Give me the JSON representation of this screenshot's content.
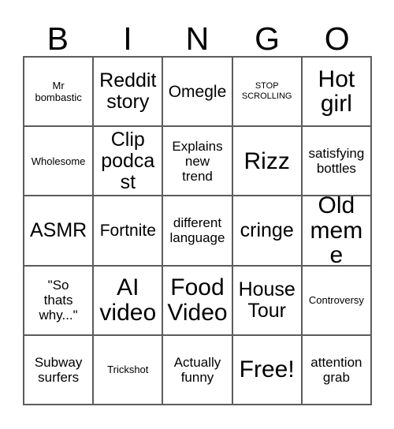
{
  "card": {
    "header_letters": [
      "B",
      "I",
      "N",
      "G",
      "O"
    ],
    "rows": [
      [
        {
          "text": "Mr\nbombastic",
          "size": "sm"
        },
        {
          "text": "Reddit\nstory",
          "size": "xl"
        },
        {
          "text": "Omegle",
          "size": "lg"
        },
        {
          "text": "STOP\nSCROLLING",
          "size": "xs"
        },
        {
          "text": "Hot\ngirl",
          "size": "xxl"
        }
      ],
      [
        {
          "text": "Wholesome",
          "size": "sm"
        },
        {
          "text": "Clip\npodcast",
          "size": "xl"
        },
        {
          "text": "Explains\nnew\ntrend",
          "size": "md"
        },
        {
          "text": "Rizz",
          "size": "xxl"
        },
        {
          "text": "satisfying\nbottles",
          "size": "md"
        }
      ],
      [
        {
          "text": "ASMR",
          "size": "xl"
        },
        {
          "text": "Fortnite",
          "size": "lg"
        },
        {
          "text": "different\nlanguage",
          "size": "md"
        },
        {
          "text": "cringe",
          "size": "xl"
        },
        {
          "text": "Old\nmeme",
          "size": "xxl"
        }
      ],
      [
        {
          "text": "\"So\nthats\nwhy...\"",
          "size": "md"
        },
        {
          "text": "AI\nvideo",
          "size": "xxl"
        },
        {
          "text": "Food\nVideo",
          "size": "xxl"
        },
        {
          "text": "House\nTour",
          "size": "xl"
        },
        {
          "text": "Controversy",
          "size": "sm"
        }
      ],
      [
        {
          "text": "Subway\nsurfers",
          "size": "md"
        },
        {
          "text": "Trickshot",
          "size": "sm"
        },
        {
          "text": "Actually\nfunny",
          "size": "md"
        },
        {
          "text": "Free!",
          "size": "xxl"
        },
        {
          "text": "attention\ngrab",
          "size": "md"
        }
      ]
    ]
  },
  "colors": {
    "background": "#ffffff",
    "text": "#000000",
    "grid_line": "#5c5c5c"
  }
}
